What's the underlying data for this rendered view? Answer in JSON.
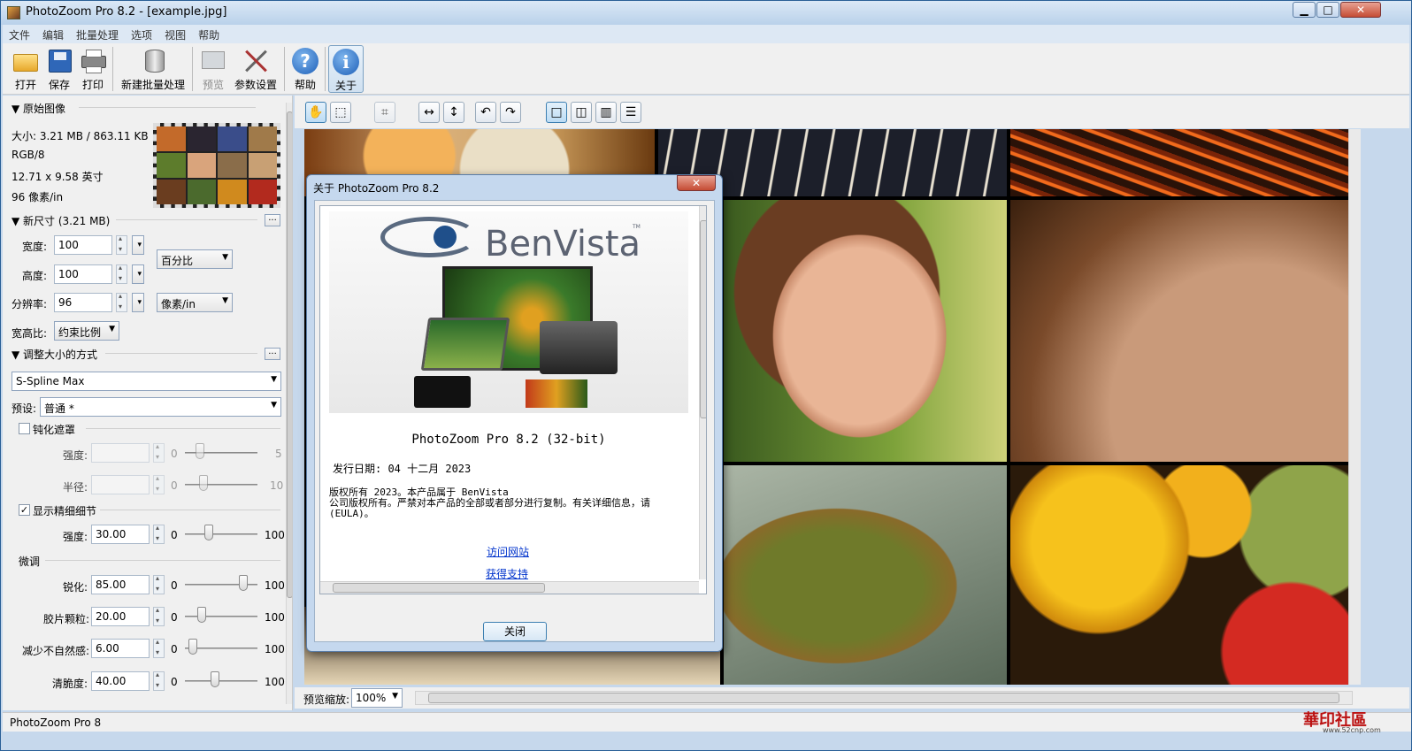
{
  "window": {
    "title": "PhotoZoom Pro 8.2 - [example.jpg]"
  },
  "menu": [
    "文件",
    "编辑",
    "批量处理",
    "选项",
    "视图",
    "帮助"
  ],
  "toolbar": {
    "open": "打开",
    "save": "保存",
    "print": "打印",
    "batch": "新建批量处理",
    "preview": "预览",
    "settings": "参数设置",
    "help": "帮助",
    "about": "关于"
  },
  "original": {
    "header": "▼ 原始图像",
    "size": "大小: 3.21 MB / 863.11 KB",
    "mode": "RGB/8",
    "dims": "12.71 x 9.58 英寸",
    "dpi": "96 像素/in"
  },
  "newsize": {
    "header": "▼ 新尺寸 (3.21 MB)",
    "width_label": "宽度:",
    "width": "100",
    "height_label": "高度:",
    "height": "100",
    "res_label": "分辨率:",
    "res": "96",
    "unit1": "百分比",
    "unit2": "像素/in",
    "aspect_label": "宽高比:",
    "aspect": "约束比例",
    "more": "..."
  },
  "method": {
    "header": "▼ 调整大小的方式",
    "algo": "S-Spline Max",
    "preset_label": "预设:",
    "preset": "普通 *",
    "unsharp": "钝化遮罩",
    "strength_label": "强度:",
    "radius_label": "半径:",
    "min": "0",
    "max5": "5",
    "max10": "10",
    "max100": "100",
    "detail": "显示精细细节",
    "detail_strength": "30.00",
    "fine": "微调",
    "sharpen_label": "锐化:",
    "sharpen": "85.00",
    "grain_label": "胶片颗粒:",
    "grain": "20.00",
    "artifact_label": "减少不自然感:",
    "artifact": "6.00",
    "crisp_label": "清脆度:",
    "crisp": "40.00"
  },
  "sliders": {
    "detail": 0.3,
    "sharpen": 0.85,
    "grain": 0.2,
    "artifact": 0.06,
    "crisp": 0.4,
    "unsharp_strength": 0.25,
    "unsharp_radius": 0.25
  },
  "bottom": {
    "zoom_label": "预览缩放:",
    "zoom": "100%"
  },
  "status": {
    "text": "PhotoZoom Pro 8"
  },
  "dialog": {
    "title": "关于 PhotoZoom Pro 8.2",
    "brand": "BenVista",
    "tm": "TM",
    "product": "PhotoZoom Pro 8.2 (32-bit)",
    "release": "发行日期: 04 十二月 2023",
    "copy1": "版权所有 2023。本产品属于 BenVista",
    "copy2": "公司版权所有。严禁对本产品的全部或者部分进行复制。有关详细信息，请",
    "copy3": "(EULA)。",
    "link1": "访问网站",
    "link2": "获得支持",
    "close": "关闭"
  },
  "watermark": "華印社區",
  "watermark_sub": "www.52cnp.com"
}
